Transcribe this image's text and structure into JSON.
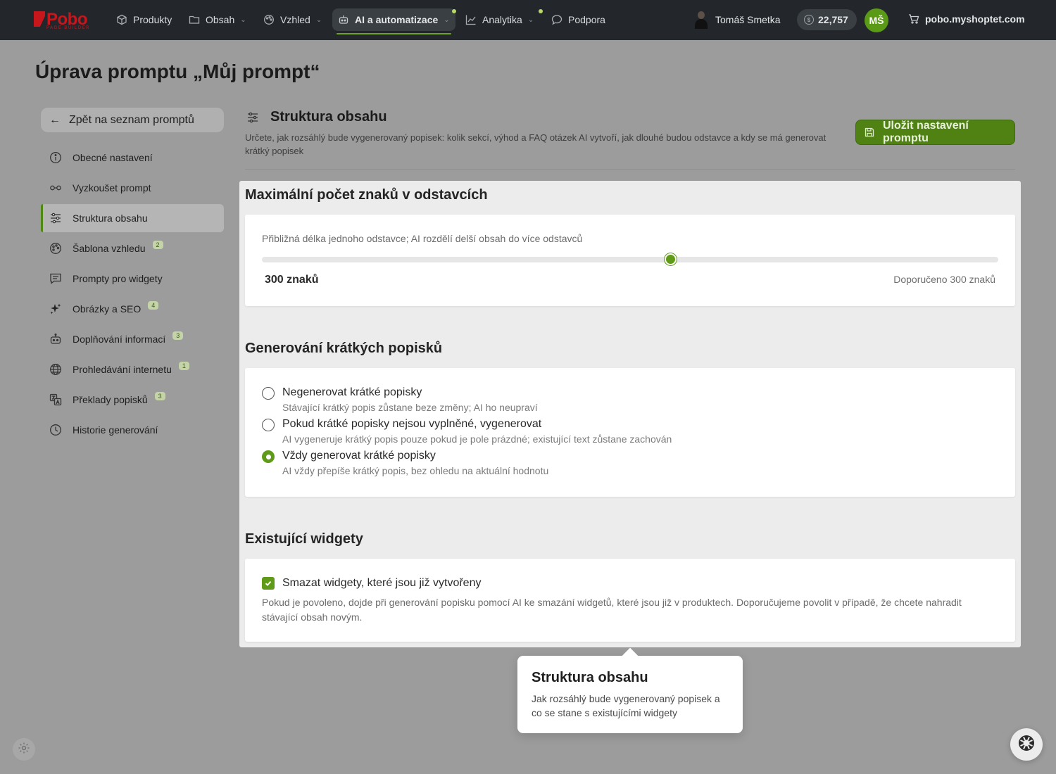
{
  "brand": {
    "name": "Pobo",
    "tagline": "PAGE BUILDER",
    "color": "#c8161d"
  },
  "nav": {
    "items": [
      {
        "label": "Produkty",
        "icon": "cube-icon"
      },
      {
        "label": "Obsah",
        "icon": "folder-icon"
      },
      {
        "label": "Vzhled",
        "icon": "palette-icon"
      },
      {
        "label": "AI a automatizace",
        "icon": "robot-icon",
        "active": true
      },
      {
        "label": "Analytika",
        "icon": "chart-icon"
      },
      {
        "label": "Podpora",
        "icon": "chat-icon"
      }
    ],
    "user_name": "Tomáš Smetka",
    "credits": "22,757",
    "avatar_initials": "MŠ",
    "shop_domain": "pobo.myshoptet.com"
  },
  "page": {
    "title": "Úprava promptu „Můj prompt“"
  },
  "sidebar": {
    "back_label": "Zpět na seznam promptů",
    "items": [
      {
        "label": "Obecné nastavení",
        "icon": "info-icon",
        "badge": ""
      },
      {
        "label": "Vyzkoušet prompt",
        "icon": "glasses-icon",
        "badge": ""
      },
      {
        "label": "Struktura obsahu",
        "icon": "sliders-icon",
        "badge": "",
        "active": true
      },
      {
        "label": "Šablona vzhledu",
        "icon": "palette-icon",
        "badge": "2"
      },
      {
        "label": "Prompty pro widgety",
        "icon": "message-icon",
        "badge": ""
      },
      {
        "label": "Obrázky a SEO",
        "icon": "sparkles-icon",
        "badge": "4"
      },
      {
        "label": "Doplňování informací",
        "icon": "robot-icon",
        "badge": "3"
      },
      {
        "label": "Prohledávání internetu",
        "icon": "globe-icon",
        "badge": "1"
      },
      {
        "label": "Překlady popisků",
        "icon": "translate-icon",
        "badge": "3"
      },
      {
        "label": "Historie generování",
        "icon": "clock-icon",
        "badge": ""
      }
    ]
  },
  "section": {
    "title": "Struktura obsahu",
    "description": "Určete, jak rozsáhlý bude vygenerovaný popisek: kolik sekcí, výhod a FAQ otázek AI vytvoří, jak dlouhé budou odstavce a kdy se má generovat krátký popisek",
    "save_label": "Uložit nastavení promptu"
  },
  "max_chars": {
    "title": "Maximální počet znaků v odstavcích",
    "hint": "Přibližná délka jednoho odstavce; AI rozdělí delší obsah do více odstavců",
    "value_label": "300 znaků",
    "recommended": "Doporučeno 300 znaků",
    "slider_fraction": 0.555
  },
  "short_desc": {
    "title": "Generování krátkých popisků",
    "options": [
      {
        "label": "Negenerovat krátké popisky",
        "desc": "Stávající krátký popis zůstane beze změny; AI ho neupraví",
        "selected": false
      },
      {
        "label": "Pokud krátké popisky nejsou vyplněné, vygenerovat",
        "desc": "AI vygeneruje krátký popis pouze pokud je pole prázdné; existující text zůstane zachován",
        "selected": false
      },
      {
        "label": "Vždy generovat krátké popisky",
        "desc": "AI vždy přepíše krátký popis, bez ohledu na aktuální hodnotu",
        "selected": true
      }
    ]
  },
  "widgets": {
    "title": "Existující widgety",
    "checkbox_label": "Smazat widgety, které jsou již vytvořeny",
    "checked": true,
    "desc": "Pokud je povoleno, dojde při generování popisku pomocí AI ke smazání widgetů, které jsou již v produktech. Doporučujeme povolit v případě, že chcete nahradit stávající obsah novým."
  },
  "tooltip": {
    "title": "Struktura obsahu",
    "text": "Jak rozsáhlý bude vygenerovaný popisek a co se stane s existujícími widgety"
  },
  "colors": {
    "accent": "#5f9b18",
    "topbar": "#23272b"
  }
}
